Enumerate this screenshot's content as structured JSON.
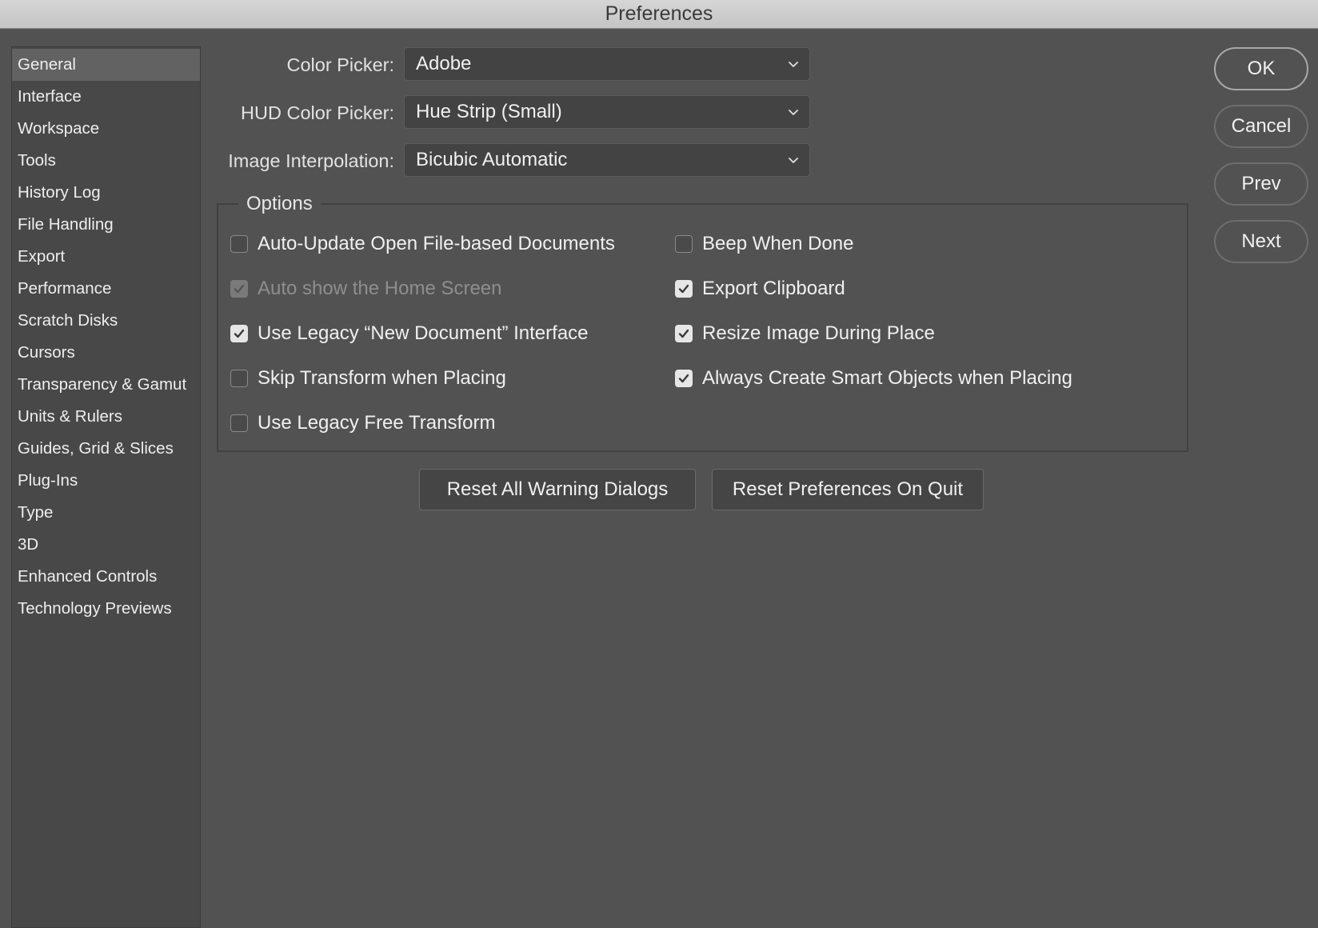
{
  "window": {
    "title": "Preferences"
  },
  "sidebar": {
    "items": [
      {
        "label": "General",
        "selected": true
      },
      {
        "label": "Interface"
      },
      {
        "label": "Workspace"
      },
      {
        "label": "Tools"
      },
      {
        "label": "History Log"
      },
      {
        "label": "File Handling"
      },
      {
        "label": "Export"
      },
      {
        "label": "Performance"
      },
      {
        "label": "Scratch Disks"
      },
      {
        "label": "Cursors"
      },
      {
        "label": "Transparency & Gamut"
      },
      {
        "label": "Units & Rulers"
      },
      {
        "label": "Guides, Grid & Slices"
      },
      {
        "label": "Plug-Ins"
      },
      {
        "label": "Type"
      },
      {
        "label": "3D"
      },
      {
        "label": "Enhanced Controls"
      },
      {
        "label": "Technology Previews"
      }
    ]
  },
  "general": {
    "color_picker": {
      "label": "Color Picker:",
      "value": "Adobe"
    },
    "hud_color_picker": {
      "label": "HUD Color Picker:",
      "value": "Hue Strip (Small)"
    },
    "image_interpolation": {
      "label": "Image Interpolation:",
      "value": "Bicubic Automatic"
    },
    "options": {
      "title": "Options",
      "left": [
        {
          "label": "Auto-Update Open File-based Documents",
          "checked": false,
          "disabled": false
        },
        {
          "label": "Auto show the Home Screen",
          "checked": true,
          "disabled": true
        },
        {
          "label": "Use Legacy “New Document” Interface",
          "checked": true,
          "disabled": false
        },
        {
          "label": "Skip Transform when Placing",
          "checked": false,
          "disabled": false
        },
        {
          "label": "Use Legacy Free Transform",
          "checked": false,
          "disabled": false
        }
      ],
      "right": [
        {
          "label": "Beep When Done",
          "checked": false,
          "disabled": false
        },
        {
          "label": "Export Clipboard",
          "checked": true,
          "disabled": false
        },
        {
          "label": "Resize Image During Place",
          "checked": true,
          "disabled": false
        },
        {
          "label": "Always Create Smart Objects when Placing",
          "checked": true,
          "disabled": false
        }
      ]
    },
    "reset_warning_label": "Reset All Warning Dialogs",
    "reset_prefs_label": "Reset Preferences On Quit"
  },
  "actions": {
    "ok": "OK",
    "cancel": "Cancel",
    "prev": "Prev",
    "next": "Next"
  },
  "colors": {
    "background": "#525252",
    "sidebar": "#484848",
    "selected_item": "#626262",
    "titlebar": "#cccccc"
  }
}
